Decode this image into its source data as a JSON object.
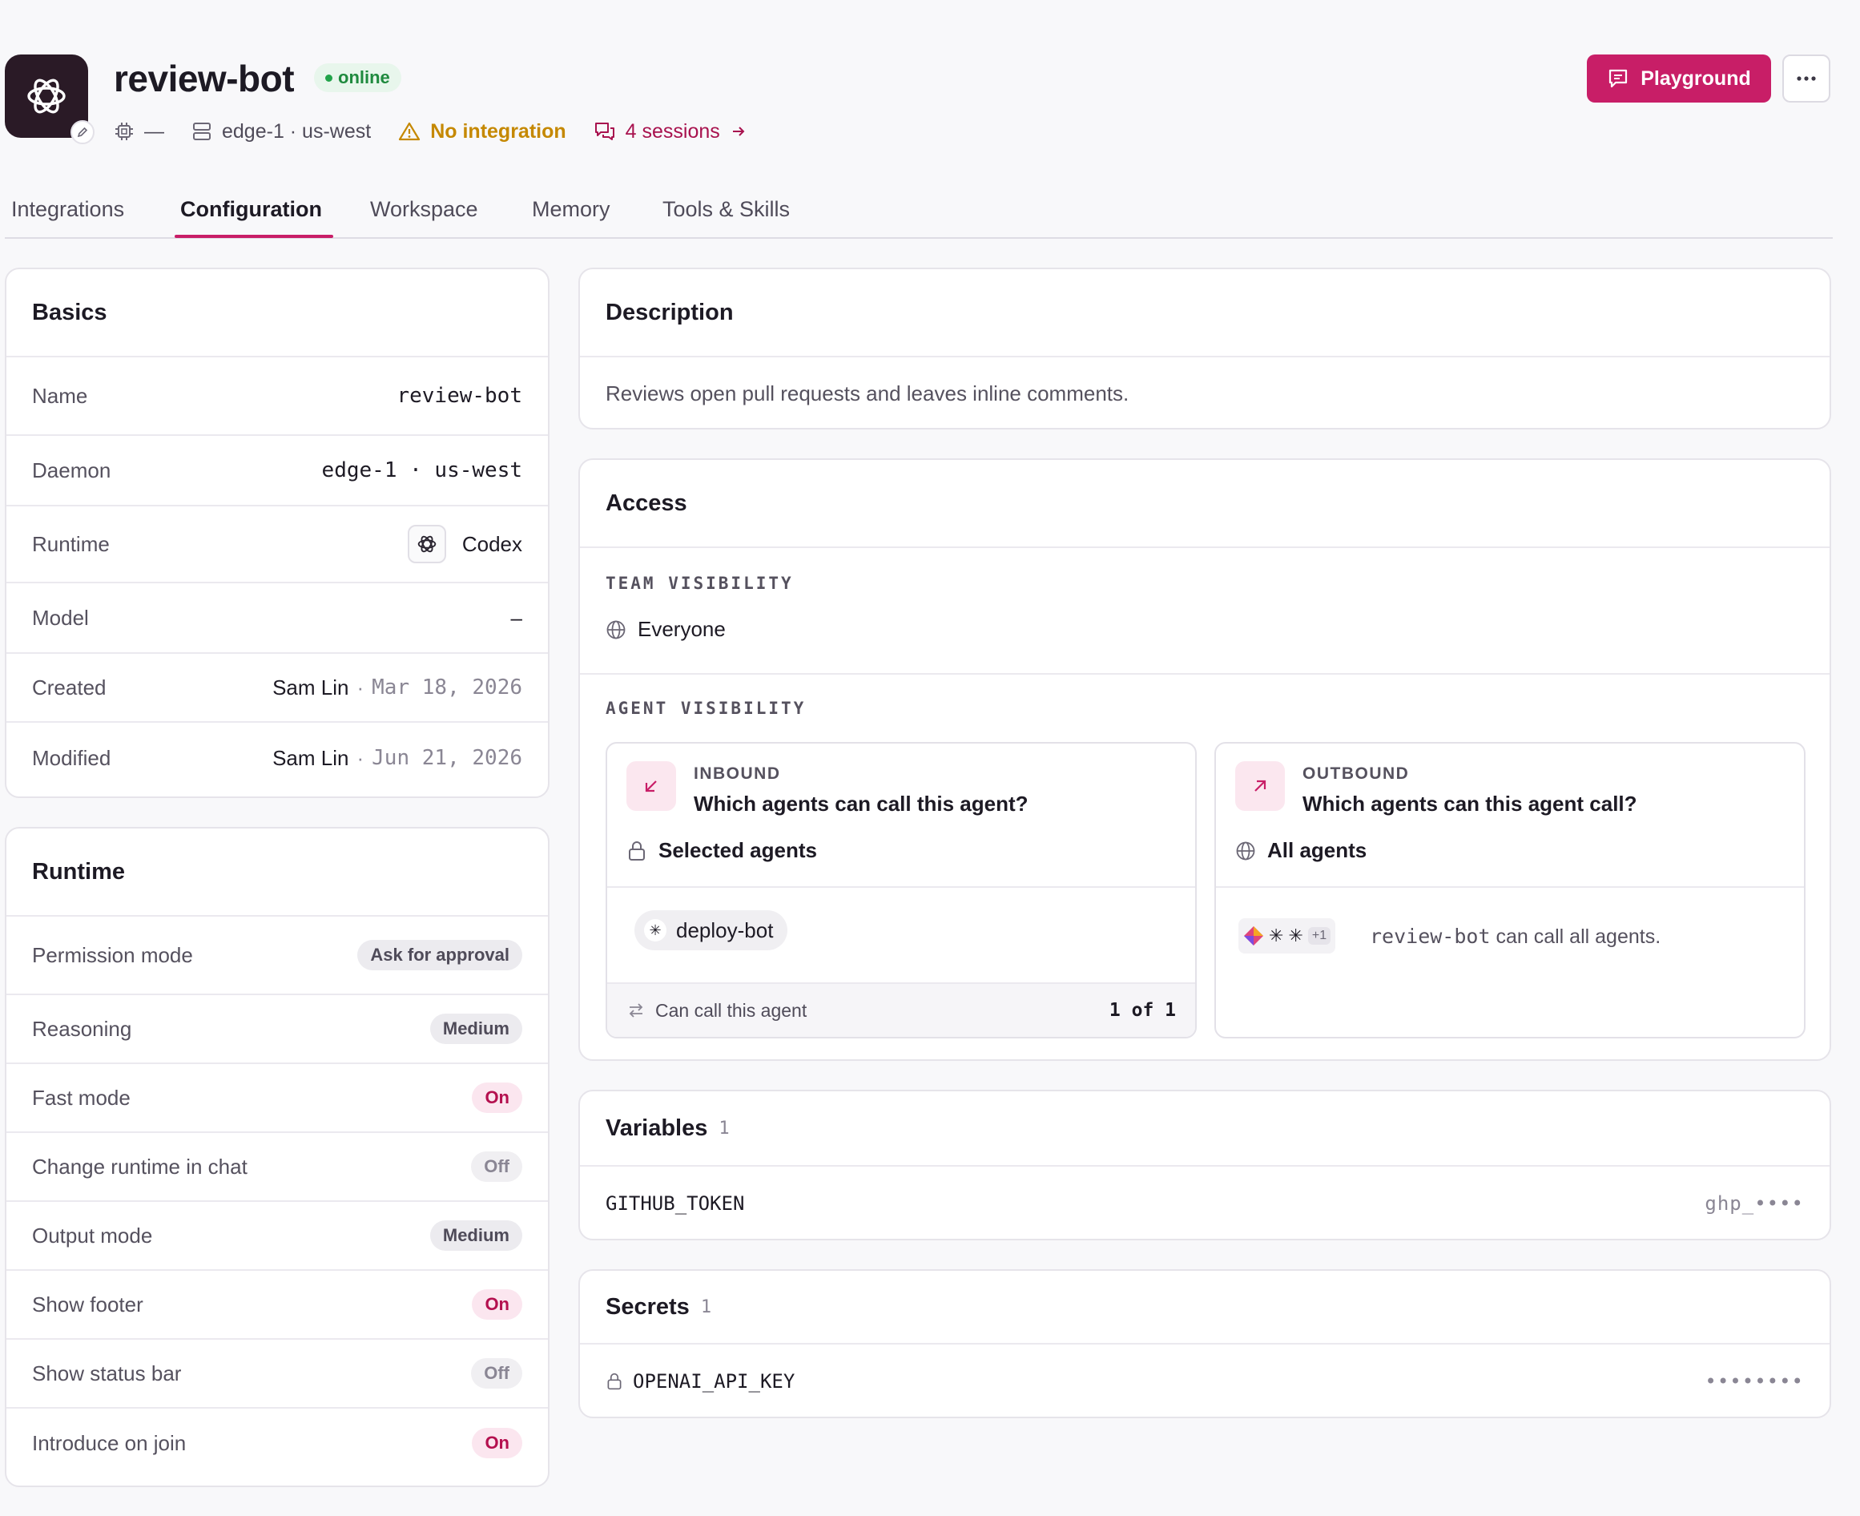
{
  "agent": {
    "name": "review-bot",
    "status": "online",
    "avatar_icon": "openai-logo-icon"
  },
  "meta": {
    "cpu_value": "—",
    "daemon": "edge-1 · us-west",
    "integration_warning": "No integration",
    "sessions": "4 sessions"
  },
  "actions": {
    "playground_label": "Playground",
    "more_icon": "more-horizontal-icon"
  },
  "tabs": [
    {
      "label": "Integrations",
      "active": false
    },
    {
      "label": "Configuration",
      "active": true
    },
    {
      "label": "Workspace",
      "active": false
    },
    {
      "label": "Memory",
      "active": false
    },
    {
      "label": "Tools & Skills",
      "active": false
    }
  ],
  "basics": {
    "title": "Basics",
    "rows": {
      "name": {
        "label": "Name",
        "value": "review-bot"
      },
      "daemon": {
        "label": "Daemon",
        "value": "edge-1 · us-west"
      },
      "runtime": {
        "label": "Runtime",
        "value": "Codex"
      },
      "model": {
        "label": "Model",
        "value": "–"
      },
      "created": {
        "label": "Created",
        "user": "Sam Lin",
        "sep": "·",
        "date": "Mar 18, 2026"
      },
      "modified": {
        "label": "Modified",
        "user": "Sam Lin",
        "sep": "·",
        "date": "Jun 21, 2026"
      }
    }
  },
  "runtime_settings": {
    "title": "Runtime",
    "rows": [
      {
        "label": "Permission mode",
        "value": "Ask for approval",
        "style": "gray"
      },
      {
        "label": "Reasoning",
        "value": "Medium",
        "style": "gray"
      },
      {
        "label": "Fast mode",
        "value": "On",
        "style": "on"
      },
      {
        "label": "Change runtime in chat",
        "value": "Off",
        "style": "off"
      },
      {
        "label": "Output mode",
        "value": "Medium",
        "style": "gray"
      },
      {
        "label": "Show footer",
        "value": "On",
        "style": "on"
      },
      {
        "label": "Show status bar",
        "value": "Off",
        "style": "off"
      },
      {
        "label": "Introduce on join",
        "value": "On",
        "style": "on"
      }
    ]
  },
  "description": {
    "title": "Description",
    "text": "Reviews open pull requests and leaves inline comments."
  },
  "access": {
    "title": "Access",
    "team_label": "TEAM VISIBILITY",
    "team_value": "Everyone",
    "agent_label": "AGENT VISIBILITY",
    "inbound": {
      "kicker": "INBOUND",
      "question": "Which agents can call this agent?",
      "scope": "Selected agents",
      "agent_chip": "deploy-bot",
      "footer_label": "Can call this agent",
      "footer_count": "1 of 1"
    },
    "outbound": {
      "kicker": "OUTBOUND",
      "question": "Which agents can this agent call?",
      "scope": "All agents",
      "stack_more": "+1",
      "agent_name": "review-bot",
      "call_text": " can call all agents."
    }
  },
  "variables": {
    "title": "Variables",
    "count": "1",
    "items": [
      {
        "key": "GITHUB_TOKEN",
        "value": "ghp_••••"
      }
    ]
  },
  "secrets": {
    "title": "Secrets",
    "count": "1",
    "items": [
      {
        "key": "OPENAI_API_KEY",
        "value": "••••••••"
      }
    ]
  },
  "colors": {
    "accent": "#c81e67",
    "online": "#22a34a",
    "warning": "#c58800"
  }
}
